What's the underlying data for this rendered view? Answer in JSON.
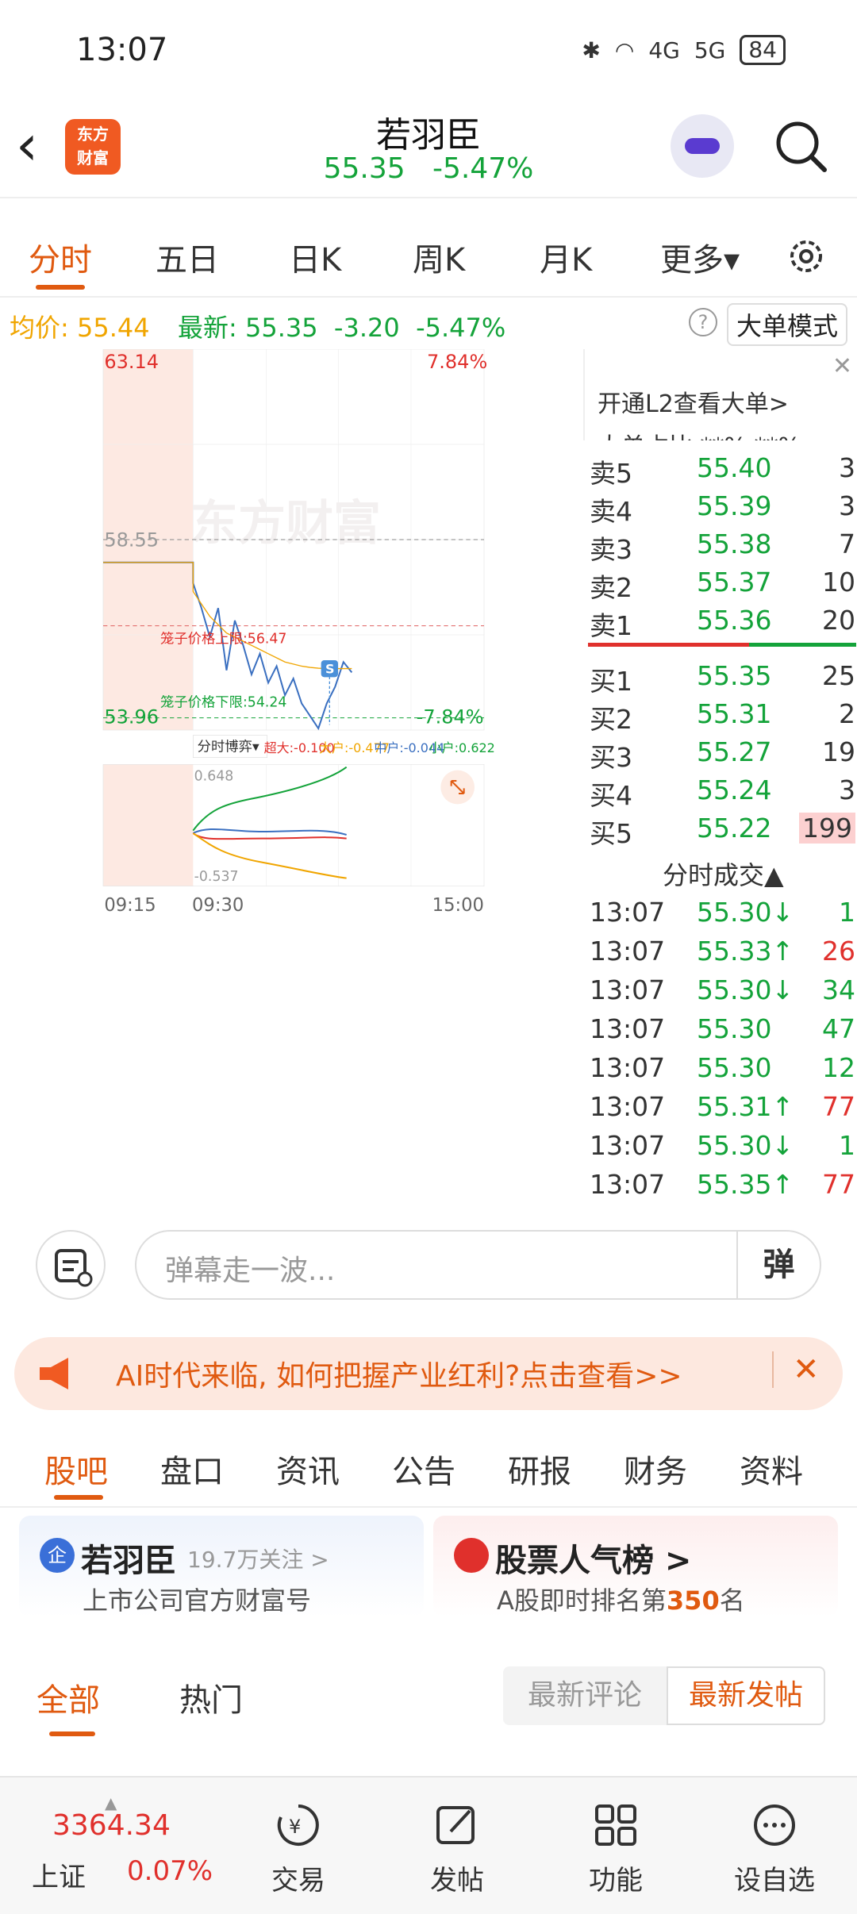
{
  "status": {
    "time": "13:07",
    "net1": "4G",
    "net2": "5G",
    "battery": "84"
  },
  "header": {
    "title": "若羽臣",
    "price": "55.35",
    "change_pct": "-5.47%",
    "logo_line1": "东方",
    "logo_line2": "财富"
  },
  "chart_tabs": [
    "分时",
    "五日",
    "日K",
    "周K",
    "月K",
    "更多▾"
  ],
  "info": {
    "avg_label": "均价:",
    "avg": "55.44",
    "latest_label": "最新:",
    "latest": "55.35",
    "diff": "-3.20",
    "pct": "-5.47%",
    "mode_button": "大单模式"
  },
  "chart": {
    "y_high": "63.14",
    "pct_high": "7.84%",
    "y_mid": "58.55",
    "y_low": "53.96",
    "pct_low": "-7.84%",
    "cage_up": "笼子价格上限:56.47",
    "cage_down": "笼子价格下限:54.24",
    "watermark": "东方财富",
    "s_marker": "S",
    "game_label": "分时博弈▾",
    "game_values": {
      "super": "超大:-0.100",
      "big": "大户:-0.477",
      "mid": "中户:-0.044",
      "small": "小户:0.622"
    },
    "sub_high": "0.648",
    "sub_low": "-0.537",
    "time_labels": [
      "09:15",
      "09:30",
      "15:00"
    ]
  },
  "chart_data": {
    "type": "line",
    "ylim": [
      53.96,
      63.14
    ],
    "series": [
      {
        "values": [
          58.0,
          58.0,
          58.0,
          58.0,
          57.5,
          56.9,
          56.2,
          56.9,
          55.4,
          56.6,
          56.0,
          55.3,
          55.8,
          55.1,
          55.5,
          54.8,
          55.2,
          54.6,
          54.3,
          54.0,
          54.6,
          55.0,
          55.6,
          55.35
        ]
      },
      {
        "values": [
          58.0,
          58.0,
          58.0,
          58.0,
          57.3,
          57.0,
          56.7,
          56.5,
          56.3,
          56.2,
          56.1,
          56.0,
          55.9,
          55.8,
          55.7,
          55.6,
          55.55,
          55.5,
          55.47,
          55.45,
          55.44,
          55.44,
          55.44,
          55.44
        ]
      }
    ]
  },
  "book": {
    "top_partial": "开通L2查看大单>",
    "top_partial2": "大单占比 **% **%",
    "asks": [
      {
        "label": "卖5",
        "price": "55.40",
        "vol": "3"
      },
      {
        "label": "卖4",
        "price": "55.39",
        "vol": "3"
      },
      {
        "label": "卖3",
        "price": "55.38",
        "vol": "7"
      },
      {
        "label": "卖2",
        "price": "55.37",
        "vol": "10"
      },
      {
        "label": "卖1",
        "price": "55.36",
        "vol": "20"
      }
    ],
    "bids": [
      {
        "label": "买1",
        "price": "55.35",
        "vol": "25"
      },
      {
        "label": "买2",
        "price": "55.31",
        "vol": "2"
      },
      {
        "label": "买3",
        "price": "55.27",
        "vol": "19"
      },
      {
        "label": "买4",
        "price": "55.24",
        "vol": "3"
      },
      {
        "label": "买5",
        "price": "55.22",
        "vol": "199"
      }
    ],
    "trades_title": "分时成交▲",
    "trades": [
      {
        "t": "13:07",
        "p": "55.30↓",
        "v": "1"
      },
      {
        "t": "13:07",
        "p": "55.33↑",
        "v": "26"
      },
      {
        "t": "13:07",
        "p": "55.30↓",
        "v": "34"
      },
      {
        "t": "13:07",
        "p": "55.30",
        "v": "47"
      },
      {
        "t": "13:07",
        "p": "55.30",
        "v": "12"
      },
      {
        "t": "13:07",
        "p": "55.31↑",
        "v": "77"
      },
      {
        "t": "13:07",
        "p": "55.30↓",
        "v": "1"
      },
      {
        "t": "13:07",
        "p": "55.35↑",
        "v": "77"
      }
    ]
  },
  "barrage": {
    "placeholder": "弹幕走一波...",
    "button": "弹"
  },
  "banner": {
    "text": "AI时代来临, 如何把握产业红利?点击查看>>"
  },
  "section_tabs": [
    "股吧",
    "盘口",
    "资讯",
    "公告",
    "研报",
    "财务",
    "资料"
  ],
  "card_left": {
    "badge": "企",
    "name": "若羽臣",
    "follow": "19.7万关注 >",
    "desc": "上市公司官方财富号"
  },
  "card_right": {
    "title": "股票人气榜 >",
    "desc_prefix": "A股即时排名第",
    "rank": "350",
    "desc_suffix": "名"
  },
  "feed_tabs": {
    "all": "全部",
    "hot": "热门",
    "sort_comment": "最新评论",
    "sort_post": "最新发帖"
  },
  "bottom": {
    "index_value": "3364.34",
    "index_name": "上证",
    "index_pct": "0.07%",
    "items": [
      "交易",
      "发帖",
      "功能",
      "设自选"
    ]
  },
  "colors": {
    "accent": "#e05a10",
    "up": "#e0302c",
    "down": "#14a33a",
    "avg": "#f0a500"
  }
}
